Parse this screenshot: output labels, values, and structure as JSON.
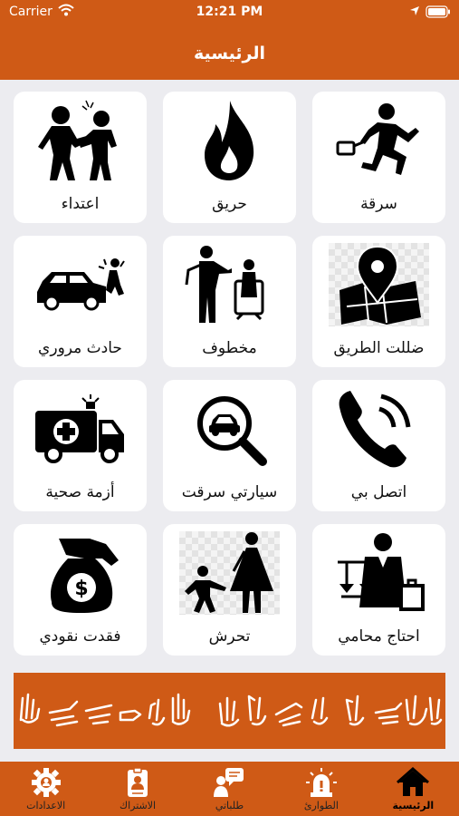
{
  "status_bar": {
    "carrier": "Carrier",
    "time": "12:21 PM"
  },
  "header": {
    "title": "الرئيسية"
  },
  "grid": {
    "items": [
      {
        "label": "اعتداء",
        "icon": "assault-icon"
      },
      {
        "label": "حريق",
        "icon": "fire-icon"
      },
      {
        "label": "سرقة",
        "icon": "thief-running-icon"
      },
      {
        "label": "حادث مروري",
        "icon": "car-accident-icon"
      },
      {
        "label": "مخطوف",
        "icon": "kidnapping-icon"
      },
      {
        "label": "ضللت الطريق",
        "icon": "map-pin-icon"
      },
      {
        "label": "أزمة صحية",
        "icon": "ambulance-icon"
      },
      {
        "label": "سيارتي سرقت",
        "icon": "car-search-icon"
      },
      {
        "label": "اتصل بي",
        "icon": "phone-call-icon"
      },
      {
        "label": "فقدت نقودي",
        "icon": "money-bag-icon"
      },
      {
        "label": "تحرش",
        "icon": "harassment-icon"
      },
      {
        "label": "احتاج محامي",
        "icon": "lawyer-icon"
      }
    ]
  },
  "banner": {
    "icon": "sign-language-icon"
  },
  "tab_bar": {
    "items": [
      {
        "label": "الرئيسية",
        "icon": "home-icon",
        "active": true
      },
      {
        "label": "الطوارئ",
        "icon": "siren-icon",
        "active": false
      },
      {
        "label": "طلباتي",
        "icon": "requests-icon",
        "active": false
      },
      {
        "label": "الاشتراك",
        "icon": "subscription-card-icon",
        "active": false
      },
      {
        "label": "الاعدادات",
        "icon": "settings-gear-icon",
        "active": false
      }
    ]
  },
  "colors": {
    "brand": "#cf5a16",
    "background": "#ececf0",
    "card": "#ffffff",
    "text": "#111111"
  }
}
